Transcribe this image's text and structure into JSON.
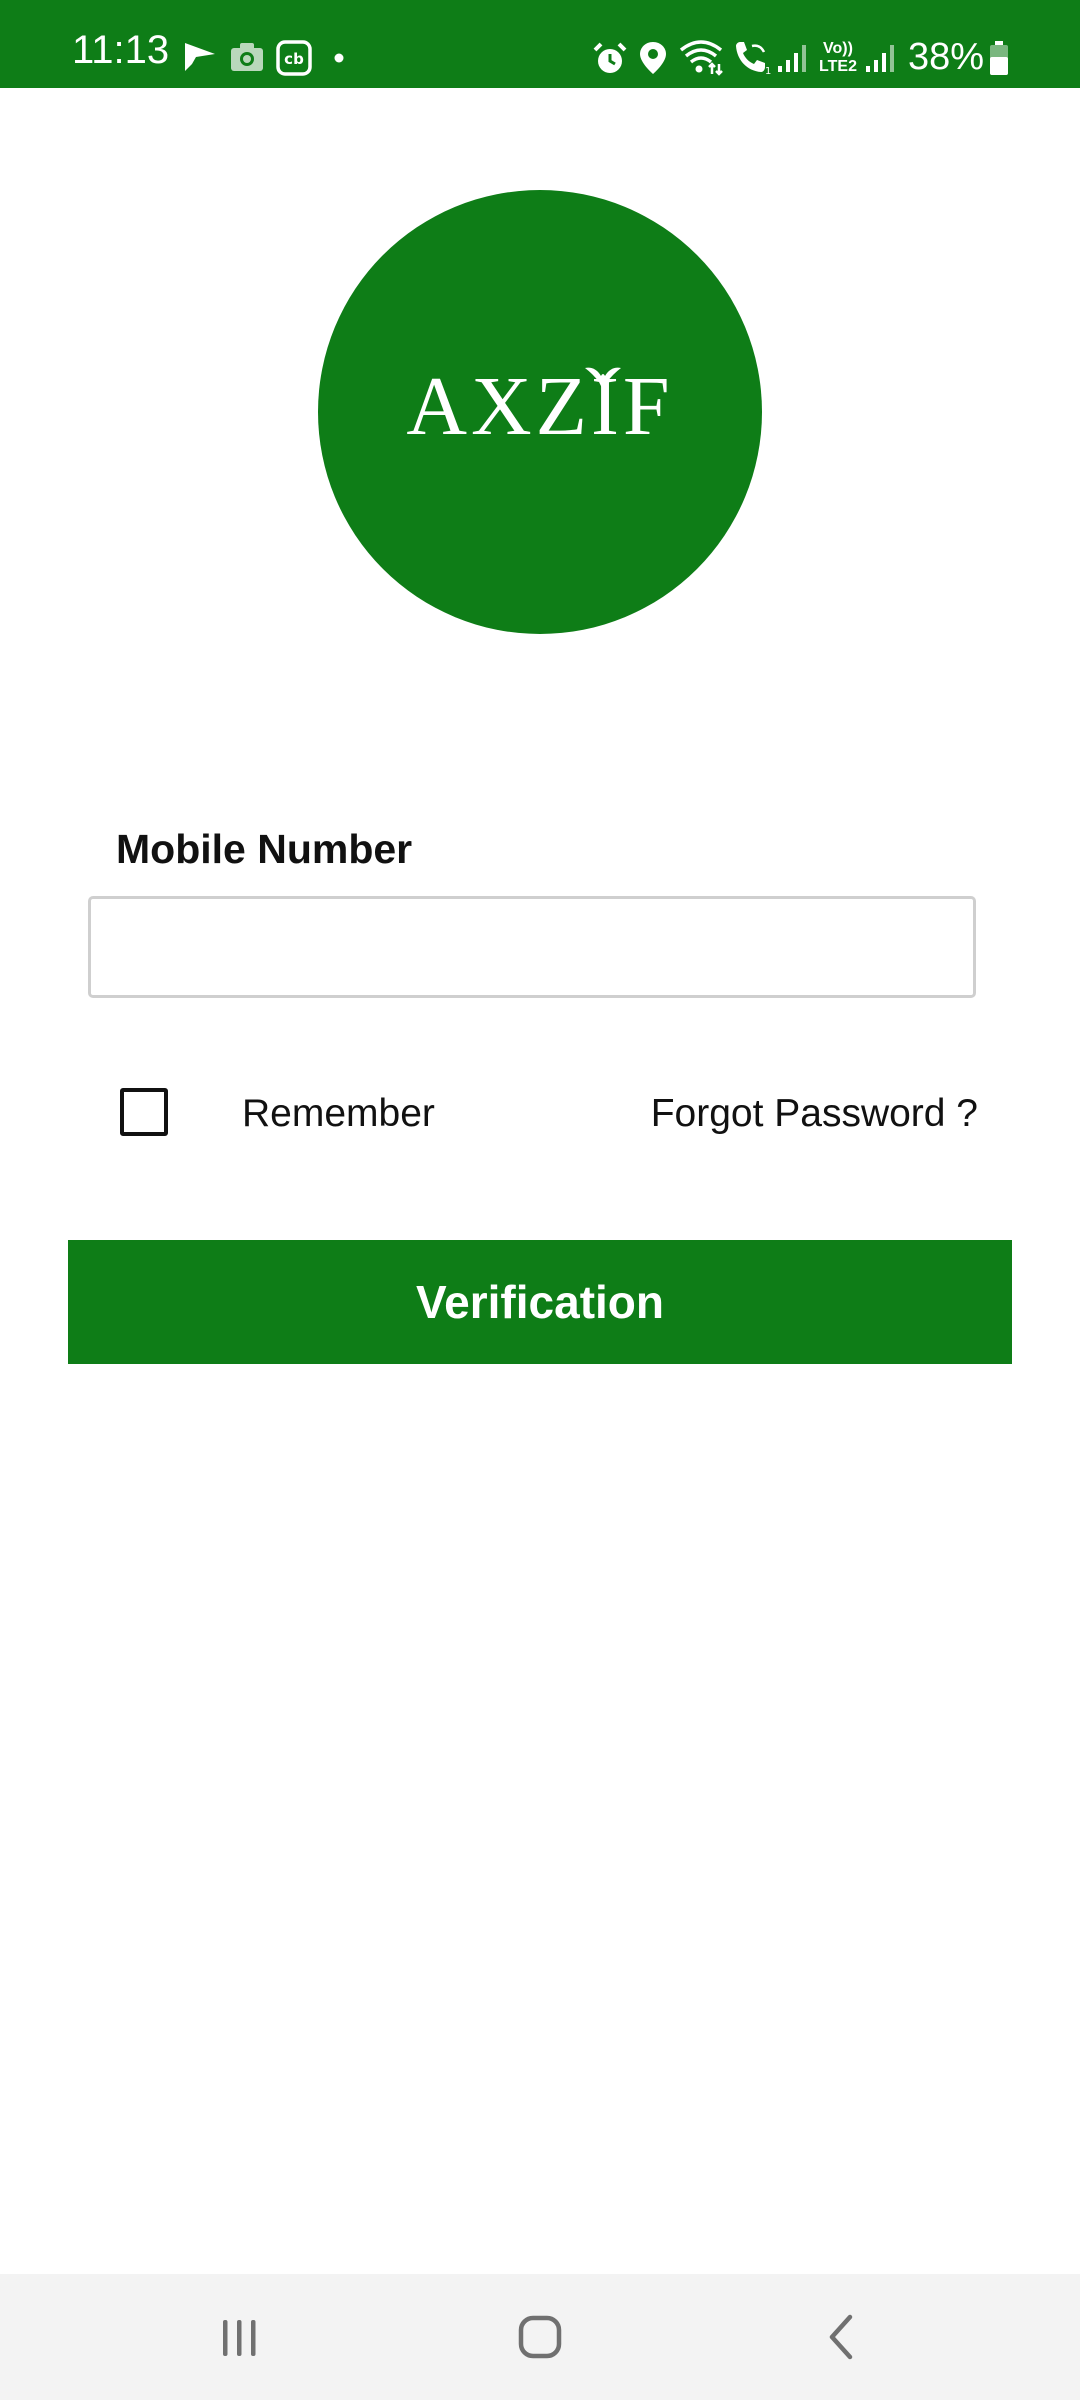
{
  "status_bar": {
    "time": "11:13",
    "battery_percent": "38%",
    "network_label": "Vo)) LTE2",
    "background_color": "#0e7d17",
    "left_icons": [
      "navigation-icon",
      "camera-icon",
      "cb-app-icon",
      "dot-icon"
    ],
    "right_icons": [
      "alarm-icon",
      "location-icon",
      "wifi-icon",
      "wifi-call-icon",
      "signal-icon",
      "signal-icon",
      "battery-icon"
    ]
  },
  "logo": {
    "text": "AXZIF",
    "color": "#0e7d17"
  },
  "form": {
    "mobile_label": "Mobile Number",
    "mobile_value": "",
    "mobile_placeholder": "",
    "remember_label": "Remember",
    "remember_checked": false,
    "forgot_label": "Forgot Password ?",
    "submit_label": "Verification",
    "accent_color": "#0e7d17"
  },
  "nav_bar": {
    "icons": [
      "recent-apps-icon",
      "home-icon",
      "back-icon"
    ]
  }
}
